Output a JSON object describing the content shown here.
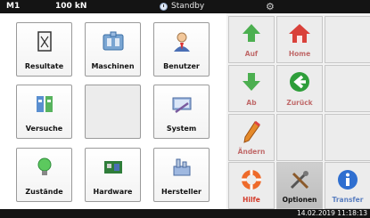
{
  "topbar": {
    "machine": "M1",
    "force": "100 kN",
    "status": "Standby",
    "status_icon": "clock-icon",
    "settings_icon": "gear-icon"
  },
  "tiles": [
    {
      "label": "Resultate",
      "icon": "results-icon"
    },
    {
      "label": "Maschinen",
      "icon": "machines-icon"
    },
    {
      "label": "Benutzer",
      "icon": "user-icon"
    },
    {
      "label": "Versuche",
      "icon": "tests-icon"
    },
    {
      "label": "",
      "icon": ""
    },
    {
      "label": "System",
      "icon": "system-icon"
    },
    {
      "label": "Zustände",
      "icon": "states-icon"
    },
    {
      "label": "Hardware",
      "icon": "hardware-icon"
    },
    {
      "label": "Hersteller",
      "icon": "manufacturer-icon"
    }
  ],
  "nav": {
    "auf": "Auf",
    "home": "Home",
    "ab": "Ab",
    "zurueck": "Zurück",
    "aendern": "Ändern",
    "hilfe": "Hilfe",
    "optionen": "Optionen",
    "transfer": "Transfer"
  },
  "datetime": "14.02.2019 11:18:13",
  "colors": {
    "bar": "#141414",
    "accent_green": "#4caf50",
    "home_red": "#d9413a",
    "nav_label": "#c06a6a"
  }
}
